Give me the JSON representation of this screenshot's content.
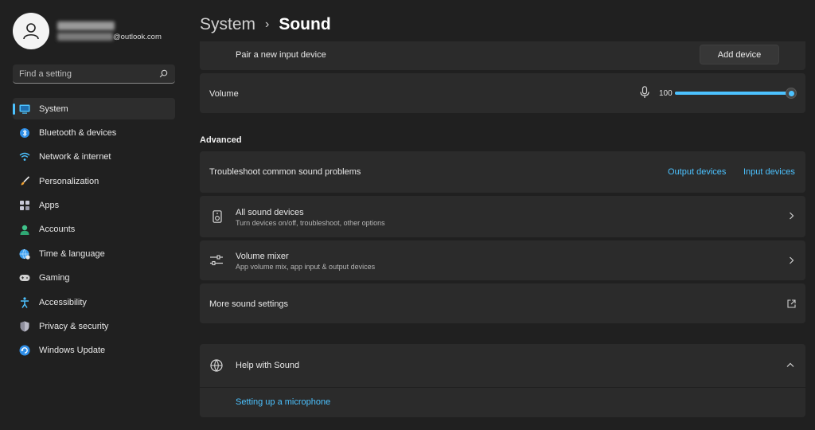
{
  "profile": {
    "email_suffix": "@outlook.com"
  },
  "search": {
    "placeholder": "Find a setting"
  },
  "nav": {
    "items": [
      {
        "label": "System",
        "icon": "monitor-icon"
      },
      {
        "label": "Bluetooth & devices",
        "icon": "bluetooth-icon"
      },
      {
        "label": "Network & internet",
        "icon": "wifi-icon"
      },
      {
        "label": "Personalization",
        "icon": "brush-icon"
      },
      {
        "label": "Apps",
        "icon": "apps-icon"
      },
      {
        "label": "Accounts",
        "icon": "person-icon"
      },
      {
        "label": "Time & language",
        "icon": "globe-clock-icon"
      },
      {
        "label": "Gaming",
        "icon": "gamepad-icon"
      },
      {
        "label": "Accessibility",
        "icon": "accessibility-icon"
      },
      {
        "label": "Privacy & security",
        "icon": "shield-icon"
      },
      {
        "label": "Windows Update",
        "icon": "update-icon"
      }
    ],
    "active_index": 0
  },
  "breadcrumb": {
    "parent": "System",
    "separator": "›",
    "current": "Sound"
  },
  "input": {
    "pair_label": "Pair a new input device",
    "add_device_label": "Add device",
    "volume_label": "Volume",
    "volume_value": "100",
    "volume_level": 1.0
  },
  "advanced": {
    "title": "Advanced",
    "troubleshoot_label": "Troubleshoot common sound problems",
    "output_devices_link": "Output devices",
    "input_devices_link": "Input devices",
    "all_devices_title": "All sound devices",
    "all_devices_subtitle": "Turn devices on/off, troubleshoot, other options",
    "mixer_title": "Volume mixer",
    "mixer_subtitle": "App volume mix, app input & output devices",
    "more_settings_label": "More sound settings"
  },
  "help": {
    "title": "Help with Sound",
    "link": "Setting up a microphone"
  },
  "colors": {
    "background": "#202020",
    "card": "#2b2b2b",
    "accent": "#4cc2ff"
  }
}
